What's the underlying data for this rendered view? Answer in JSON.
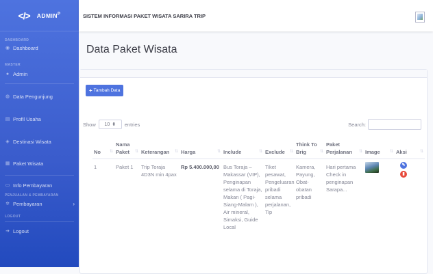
{
  "sidebar": {
    "brand_logo": "</>",
    "brand_label": "ADMIN",
    "brand_sup": "P",
    "headings": [
      "DASHBOARD",
      "MASTER",
      "PENJUALAN & PEMBAYARAN",
      "LOGOUT"
    ],
    "items": [
      {
        "label": "Dashboard",
        "icon": "gauge-icon"
      },
      {
        "label": "Admin",
        "icon": "user-icon"
      },
      {
        "label": "Data Pengunjung",
        "icon": "users-icon"
      },
      {
        "label": "Profil Usaha",
        "icon": "file-icon"
      },
      {
        "label": "Destinasi Wisata",
        "icon": "map-icon"
      },
      {
        "label": "Paket Wisata",
        "icon": "table-icon"
      },
      {
        "label": "Info Pembayaran",
        "icon": "money-icon"
      },
      {
        "label": "Pembayaran",
        "icon": "gear-icon"
      },
      {
        "label": "Logout",
        "icon": "signout-icon"
      }
    ]
  },
  "topbar": {
    "app_title": "SISTEM INFORMASI PAKET WISATA SARIRA TRIP"
  },
  "page": {
    "title": "Data Paket Wisata",
    "add_button": "Tambah Data",
    "show_label": "Show",
    "entries_value": "10",
    "entries_label": "entries",
    "search_label": "Search:",
    "search_value": ""
  },
  "table": {
    "headers": [
      "No",
      "Nama Paket",
      "Keterangan",
      "Harga",
      "Include",
      "Exclude",
      "Think To Brig",
      "Paket Perjalanan",
      "Image",
      "Aksi"
    ],
    "rows": [
      {
        "no": "1",
        "nama": "Paket 1",
        "keterangan": "Trip Toraja 4D3N min 4pax",
        "harga": "Rp 5.400.000,00",
        "include": "Bus Toraja – Makassar (VIP), Penginapan selama di Toraja, Makan ( Pagi-Siang-Malam ), Air mineral, Simaksi, Guide Local",
        "exclude": "Tiket pesawat, Pengeluaran pribadi selama perjalanan, Tip",
        "think_to_brig": "Kamera, Payung, Obat-obatan pribadi",
        "paket_perjalanan": "Hari pertama Check in penginapan Sarapa...",
        "image": "landscape-thumbnail",
        "actions": [
          "edit",
          "delete"
        ]
      }
    ]
  },
  "colors": {
    "primary": "#4e73df",
    "danger": "#e74a3b",
    "sidebar_dark": "#224abe"
  }
}
